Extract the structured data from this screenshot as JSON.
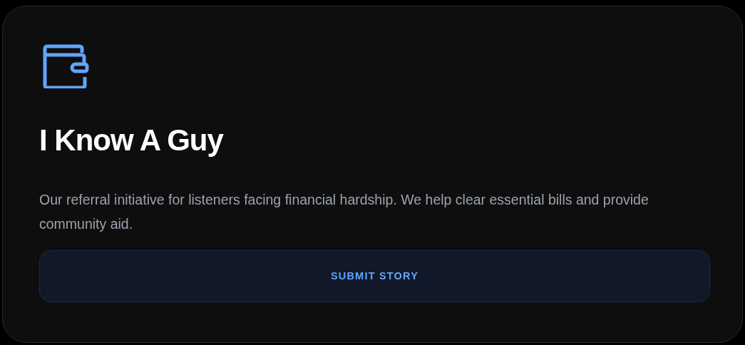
{
  "card": {
    "title": "I Know A Guy",
    "description": "Our referral initiative for listeners facing financial hardship. We help clear essential bills and provide community aid.",
    "button": "SUBMIT STORY"
  }
}
